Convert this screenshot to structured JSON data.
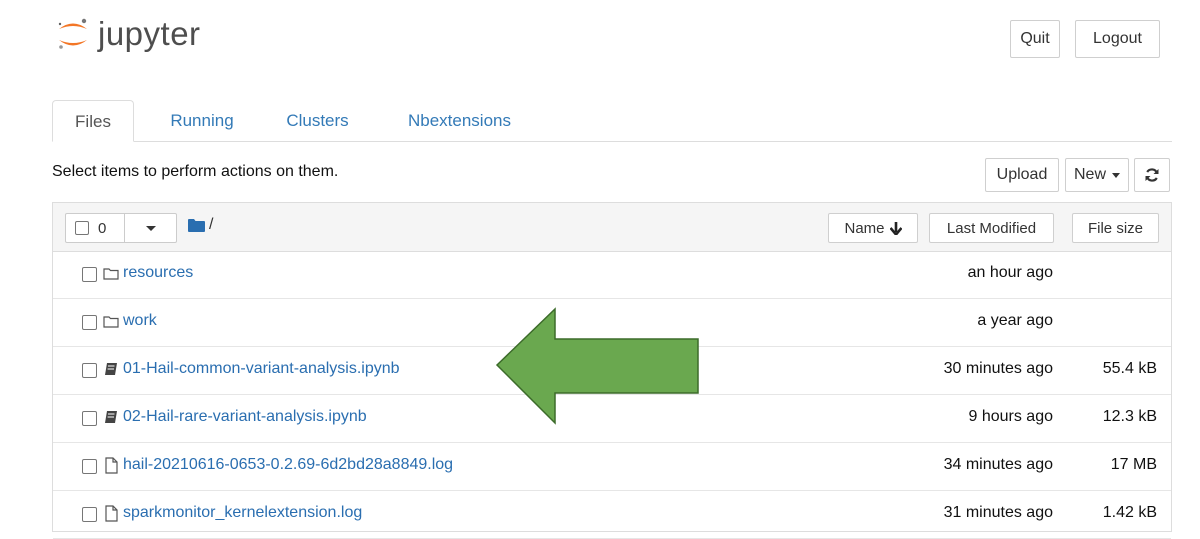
{
  "header": {
    "logo_text": "jupyter",
    "quit_label": "Quit",
    "logout_label": "Logout"
  },
  "tabs": [
    {
      "label": "Files",
      "active": true
    },
    {
      "label": "Running",
      "active": false
    },
    {
      "label": "Clusters",
      "active": false
    },
    {
      "label": "Nbextensions",
      "active": false
    }
  ],
  "toolbar": {
    "instructions": "Select items to perform actions on them.",
    "upload_label": "Upload",
    "new_label": "New",
    "refresh_icon": "refresh-icon"
  },
  "list_header": {
    "selected_count": "0",
    "path": "/",
    "name_label": "Name",
    "last_modified_label": "Last Modified",
    "file_size_label": "File size"
  },
  "items": [
    {
      "type": "folder",
      "icon": "folder-icon",
      "name": "resources",
      "modified": "an hour ago",
      "size": ""
    },
    {
      "type": "folder",
      "icon": "folder-icon",
      "name": "work",
      "modified": "a year ago",
      "size": ""
    },
    {
      "type": "notebook",
      "icon": "notebook-icon",
      "name": "01-Hail-common-variant-analysis.ipynb",
      "modified": "30 minutes ago",
      "size": "55.4 kB"
    },
    {
      "type": "notebook",
      "icon": "notebook-icon",
      "name": "02-Hail-rare-variant-analysis.ipynb",
      "modified": "9 hours ago",
      "size": "12.3 kB"
    },
    {
      "type": "file",
      "icon": "file-icon",
      "name": "hail-20210616-0653-0.2.69-6d2bd28a8849.log",
      "modified": "34 minutes ago",
      "size": "17 MB"
    },
    {
      "type": "file",
      "icon": "file-icon",
      "name": "sparkmonitor_kernelextension.log",
      "modified": "31 minutes ago",
      "size": "1.42 kB"
    }
  ],
  "colors": {
    "link": "#2a6eb0",
    "arrow_fill": "#6aa84f",
    "arrow_stroke": "#3c6b2a",
    "logo_orange": "#f37626"
  }
}
